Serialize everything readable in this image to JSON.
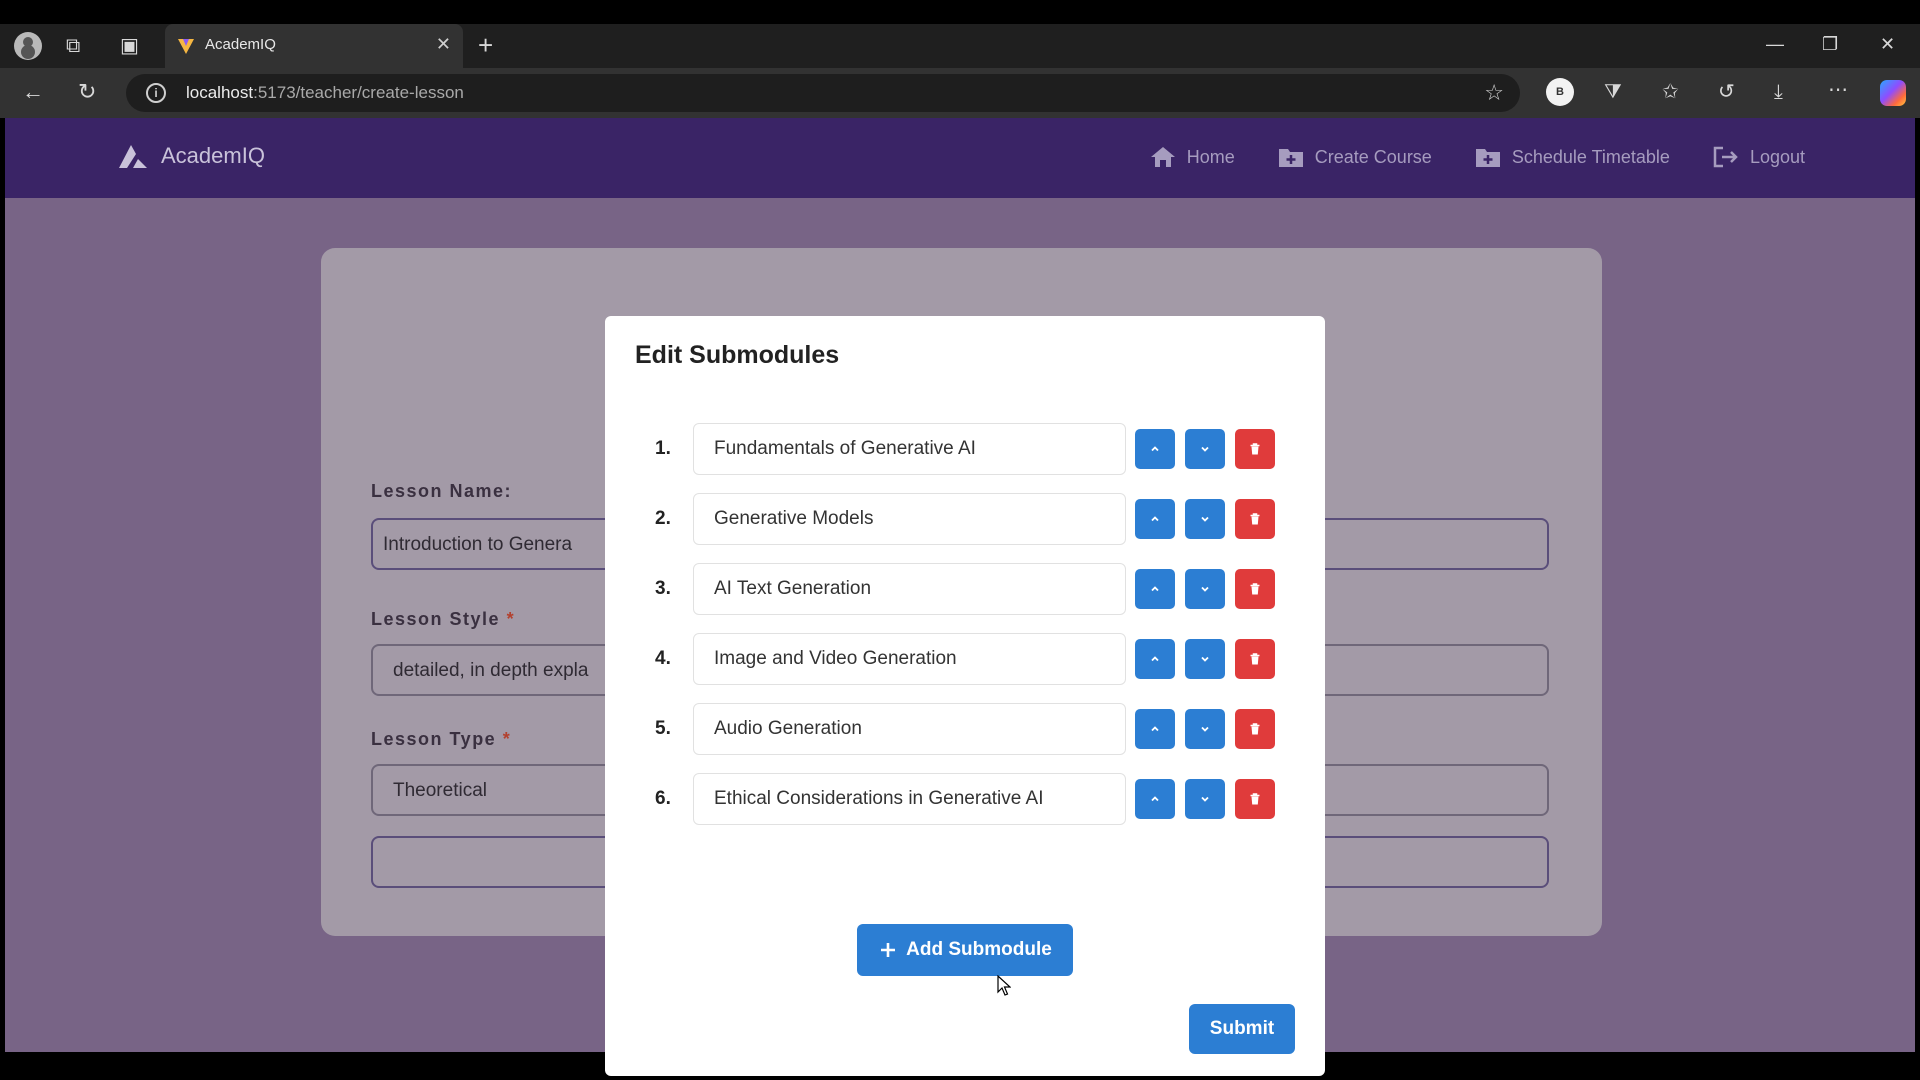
{
  "browser": {
    "tab_title": "AcademIQ",
    "url_host": "localhost",
    "url_path": ":5173/teacher/create-lesson",
    "profile_initial": "B"
  },
  "navbar": {
    "brand": "AcademIQ",
    "links": [
      {
        "label": "Home",
        "icon": "home-icon"
      },
      {
        "label": "Create Course",
        "icon": "folder-plus-icon"
      },
      {
        "label": "Schedule Timetable",
        "icon": "calendar-folder-icon"
      },
      {
        "label": "Logout",
        "icon": "logout-icon"
      }
    ]
  },
  "form": {
    "lesson_name_label": "Lesson Name:",
    "lesson_name_value": "Introduction to Genera",
    "lesson_style_label": "Lesson Style",
    "lesson_style_value": "detailed, in depth expla",
    "lesson_type_label": "Lesson Type",
    "lesson_type_value": "Theoretical",
    "required_mark": "*"
  },
  "modal": {
    "title": "Edit Submodules",
    "submodules": [
      {
        "num": "1.",
        "name": "Fundamentals of Generative AI"
      },
      {
        "num": "2.",
        "name": "Generative Models"
      },
      {
        "num": "3.",
        "name": "AI Text Generation"
      },
      {
        "num": "4.",
        "name": "Image and Video Generation"
      },
      {
        "num": "5.",
        "name": "Audio Generation"
      },
      {
        "num": "6.",
        "name": "Ethical Considerations in Generative AI"
      }
    ],
    "add_label": "Add Submodule",
    "submit_label": "Submit"
  },
  "colors": {
    "navbar": "#3a2466",
    "page_bg": "#786486",
    "primary_button": "#2c7ed3",
    "danger_button": "#e03b3b"
  }
}
